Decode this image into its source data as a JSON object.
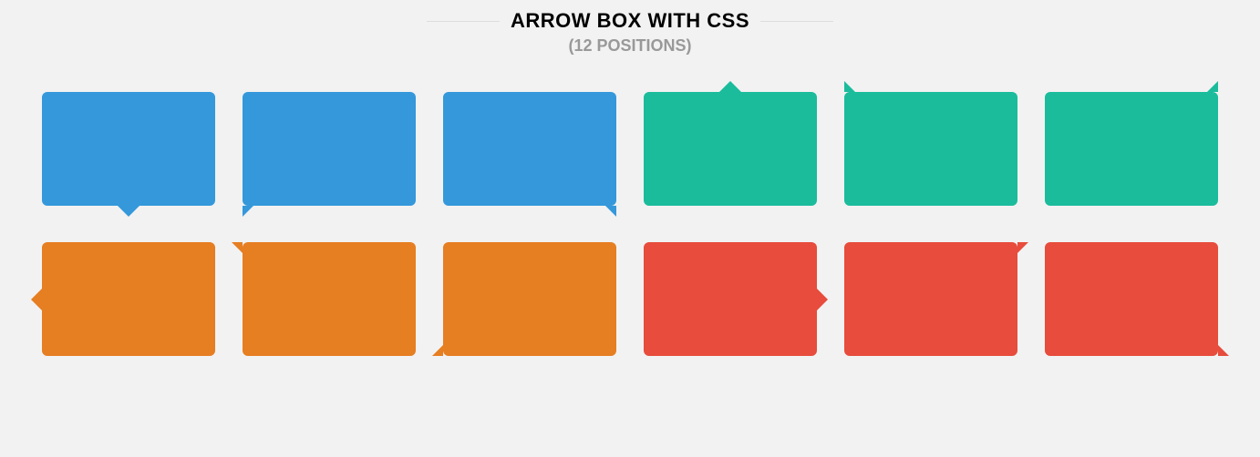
{
  "header": {
    "title": "ARROW BOX WITH CSS",
    "subtitle": "(12 POSITIONS)"
  },
  "colors": {
    "blue": "#3498db",
    "green": "#1abc9c",
    "orange": "#e67e22",
    "red": "#e74c3c",
    "background": "#f2f2f2"
  },
  "boxes": [
    {
      "color": "blue",
      "arrow": "bottom-center"
    },
    {
      "color": "blue",
      "arrow": "bottom-left"
    },
    {
      "color": "blue",
      "arrow": "bottom-right"
    },
    {
      "color": "green",
      "arrow": "top-center"
    },
    {
      "color": "green",
      "arrow": "top-left"
    },
    {
      "color": "green",
      "arrow": "top-right"
    },
    {
      "color": "orange",
      "arrow": "left-center"
    },
    {
      "color": "orange",
      "arrow": "left-top"
    },
    {
      "color": "orange",
      "arrow": "left-bottom"
    },
    {
      "color": "red",
      "arrow": "right-center"
    },
    {
      "color": "red",
      "arrow": "right-top"
    },
    {
      "color": "red",
      "arrow": "right-bottom"
    }
  ]
}
